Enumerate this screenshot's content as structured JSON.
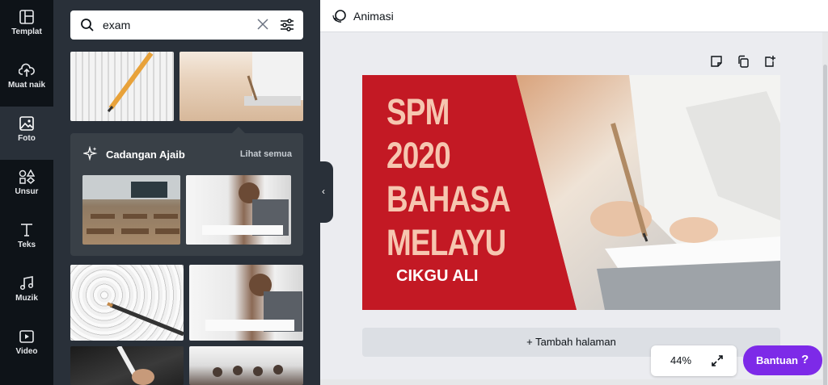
{
  "rail": {
    "items": [
      {
        "label": "Templat",
        "icon": "layout-icon"
      },
      {
        "label": "Muat naik",
        "icon": "upload-cloud-icon"
      },
      {
        "label": "Foto",
        "icon": "image-icon"
      },
      {
        "label": "Unsur",
        "icon": "shapes-icon"
      },
      {
        "label": "Teks",
        "icon": "text-icon"
      },
      {
        "label": "Muzik",
        "icon": "music-icon"
      },
      {
        "label": "Video",
        "icon": "video-icon"
      }
    ],
    "active": "Foto"
  },
  "search": {
    "value": "exam"
  },
  "magic": {
    "title": "Cadangan Ajaib",
    "link": "Lihat semua"
  },
  "topbar": {
    "animation_label": "Animasi"
  },
  "design": {
    "title_lines": [
      "SPM",
      "2020",
      "BAHASA",
      "MELAYU"
    ],
    "subtitle": "CIKGU ALI",
    "red": "#c31924",
    "peach": "#f6c6b0"
  },
  "canvas": {
    "add_page_label": "+ Tambah halaman"
  },
  "zoom": {
    "value": "44%"
  },
  "help": {
    "label": "Bantuan",
    "glyph": "?"
  },
  "colors": {
    "rail": "#0e1318",
    "panel": "#293039",
    "accent": "#7d2ae8"
  }
}
